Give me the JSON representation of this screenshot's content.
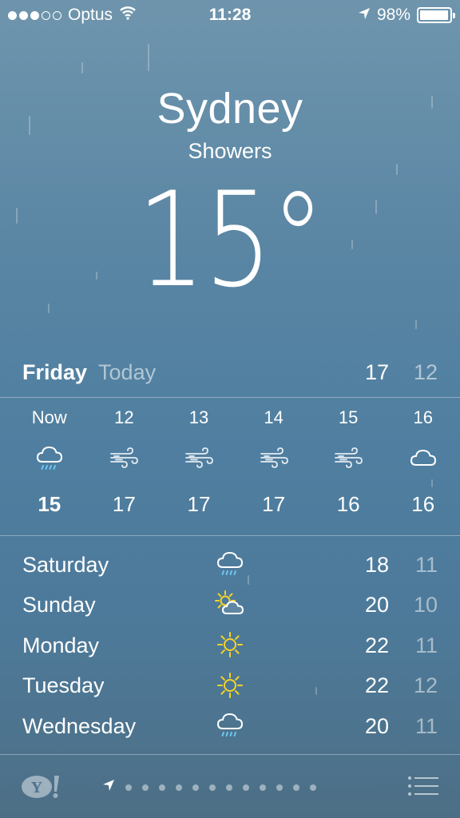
{
  "status_bar": {
    "carrier": "Optus",
    "time": "11:28",
    "battery": "98%",
    "battery_level": 0.98,
    "signal_filled": 3,
    "signal_total": 5
  },
  "location": {
    "city": "Sydney",
    "condition": "Showers",
    "temperature": "15°"
  },
  "today": {
    "day": "Friday",
    "label": "Today",
    "high": "17",
    "low": "12"
  },
  "hourly": [
    {
      "time": "Now",
      "icon": "rain-cloud-icon",
      "temp": "15"
    },
    {
      "time": "12",
      "icon": "wind-icon",
      "temp": "17"
    },
    {
      "time": "13",
      "icon": "wind-icon",
      "temp": "17"
    },
    {
      "time": "14",
      "icon": "wind-icon",
      "temp": "17"
    },
    {
      "time": "15",
      "icon": "wind-icon",
      "temp": "16"
    },
    {
      "time": "16",
      "icon": "cloud-icon",
      "temp": "16"
    }
  ],
  "daily": [
    {
      "day": "Saturday",
      "icon": "rain-cloud-icon",
      "high": "18",
      "low": "11"
    },
    {
      "day": "Sunday",
      "icon": "partly-sunny-icon",
      "high": "20",
      "low": "10"
    },
    {
      "day": "Monday",
      "icon": "sun-icon",
      "high": "22",
      "low": "11"
    },
    {
      "day": "Tuesday",
      "icon": "sun-icon",
      "high": "22",
      "low": "12"
    },
    {
      "day": "Wednesday",
      "icon": "rain-cloud-icon",
      "high": "20",
      "low": "11"
    }
  ],
  "pager": {
    "pages": 12,
    "current": 0
  },
  "colors": {
    "sun": "#f5d327",
    "rain": "#6fc6f2"
  }
}
